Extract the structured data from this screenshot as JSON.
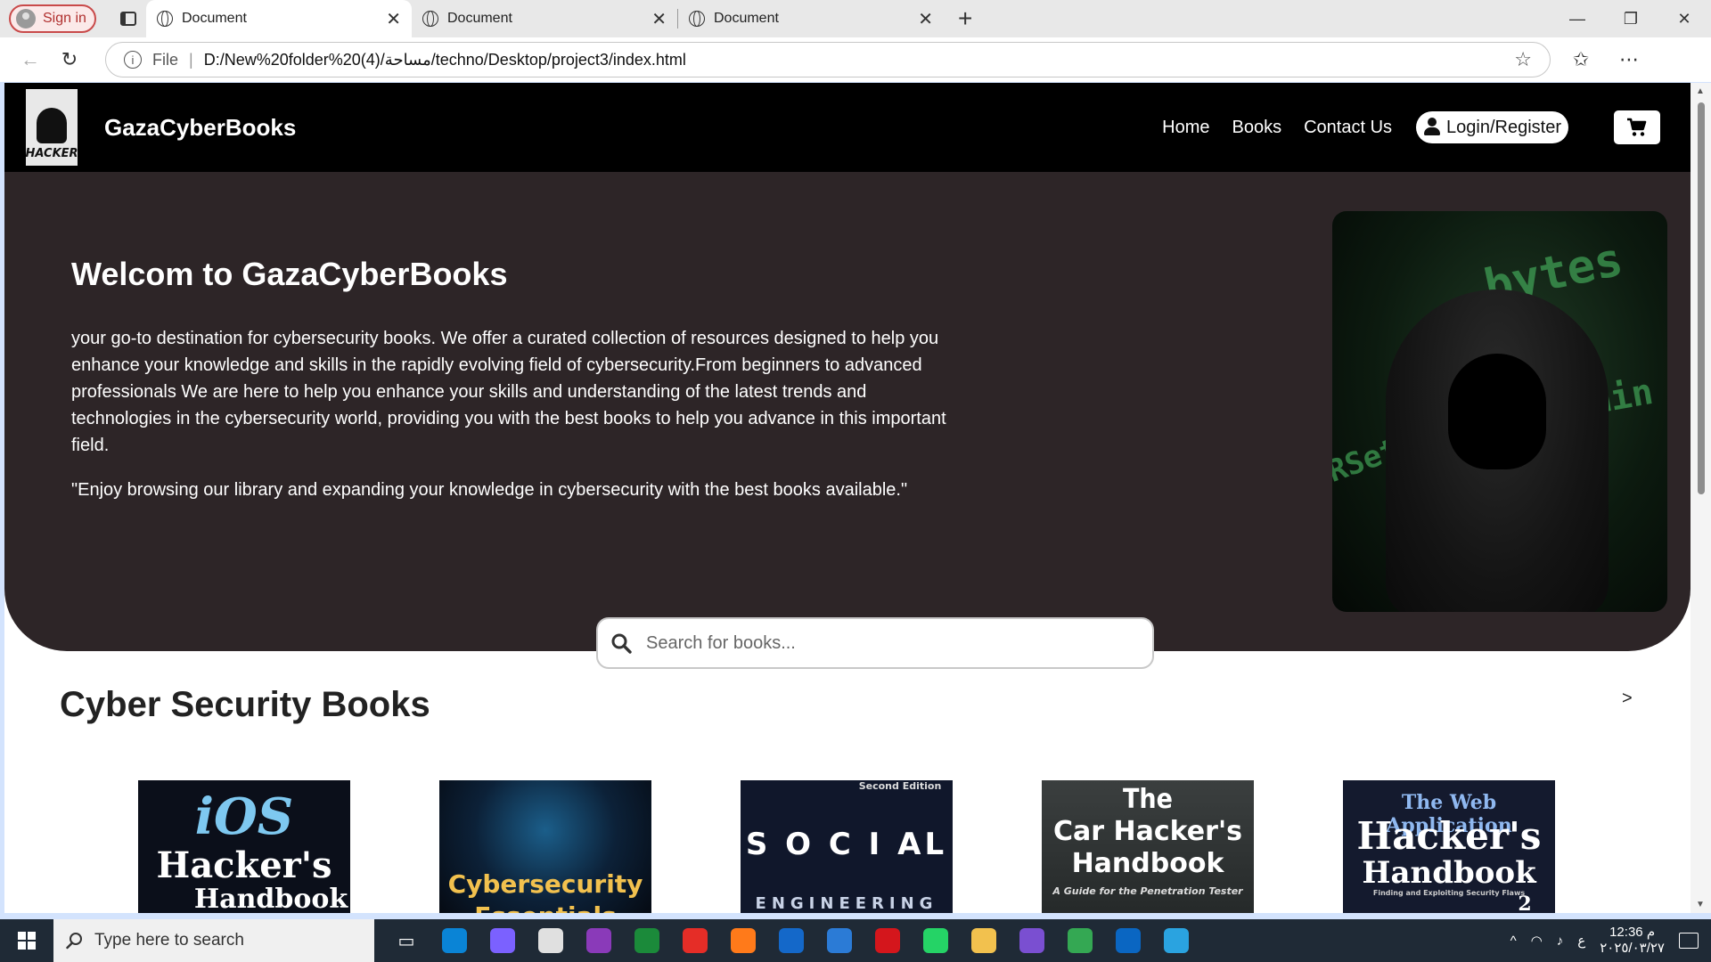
{
  "browser": {
    "signin_label": "Sign in",
    "tabs": [
      {
        "title": "Document",
        "active": true
      },
      {
        "title": "Document",
        "active": false
      },
      {
        "title": "Document",
        "active": false
      }
    ],
    "address": {
      "scheme_label": "File",
      "url": "D:/New%20folder%20(4)/مساحة/techno/Desktop/project3/index.html"
    }
  },
  "site": {
    "logo_text": "HACKER",
    "brand": "GazaCyberBooks",
    "nav": {
      "home": "Home",
      "books": "Books",
      "contact": "Contact Us",
      "login": "Login/Register"
    },
    "hero": {
      "title": "Welcom to GazaCyberBooks",
      "description": "your go-to destination for cybersecurity books. We offer a curated collection of resources designed to help you enhance your knowledge and skills in the rapidly evolving field of cybersecurity.From beginners to advanced professionals We are here to help you enhance your skills and understanding of the latest trends and technologies in the cybersecurity world, providing you with the best books to help you advance in this important field.",
      "quote": "\"Enjoy browsing our library and expanding your knowledge in cybersecurity with the best books available.\"",
      "image_code": {
        "a": "bytes",
        "b": "admin",
        "c": "RSet"
      }
    },
    "search": {
      "placeholder": "Search for books..."
    },
    "section_title": "Cyber Security Books",
    "section_arrow": ">",
    "books": [
      {
        "line1": "iOS",
        "line2": "Hacker's",
        "line3": "Handbook"
      },
      {
        "line1": "Cybersecurity",
        "line2": "Essentials"
      },
      {
        "line1": "Second Edition",
        "line2": "S O C I AL",
        "line3": "ENGINEERING"
      },
      {
        "line1": "The",
        "line2": "Car Hacker's",
        "line3": "Handbook",
        "line4": "A Guide for the Penetration Tester"
      },
      {
        "line1": "The Web Application",
        "line2": "Hacker's",
        "line3": "Handbook",
        "line4": "Finding and Exploiting Security Flaws",
        "line5": "2"
      }
    ]
  },
  "taskbar": {
    "search_placeholder": "Type here to search",
    "time": "12:36 م",
    "date": "٢٠٢٥/٠٣/٢٧",
    "lang": "ع",
    "app_colors": [
      "#0a84d6",
      "#7b61ff",
      "#e0e0e0",
      "#8a3ab9",
      "#1b8a3a",
      "#e52d27",
      "#ff7a1a",
      "#1468c9",
      "#2b7bd6",
      "#d4161c",
      "#25d366",
      "#f2c14e",
      "#7a4fd1",
      "#34a853",
      "#0a66c2",
      "#2aa3e0"
    ]
  }
}
